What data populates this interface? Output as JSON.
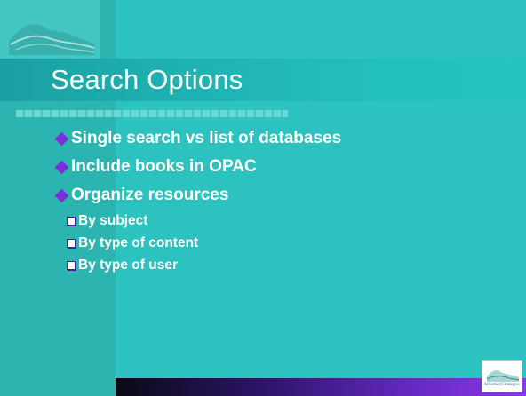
{
  "slide": {
    "title": "Search Options",
    "bullets": [
      {
        "text": "Single search vs list of databases"
      },
      {
        "text": "Include books in OPAC"
      },
      {
        "text": "Organize resources",
        "sub": [
          {
            "text": "By subject"
          },
          {
            "text": "By type of content"
          },
          {
            "text": "By type of user"
          }
        ]
      }
    ],
    "footer_logo_text": "Informed Strategies"
  },
  "colors": {
    "background": "#2bc2bf",
    "title_bar": "#1eb0b0",
    "bullet_diamond": "#7a2fd8",
    "sub_bullet_box": "#4b1c9c",
    "bottom_bar": "#6a2ac8"
  },
  "icons": {
    "bullet_level1": "diamond-bullet-icon",
    "bullet_level2": "checkbox-bullet-icon",
    "logo": "mountain-waves-logo"
  }
}
